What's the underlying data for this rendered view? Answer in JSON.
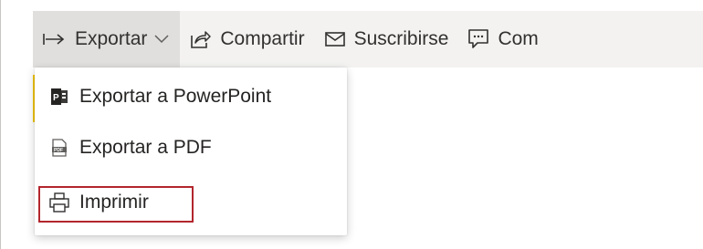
{
  "toolbar": {
    "items": [
      {
        "label": "Exportar",
        "icon": "arrow-right-icon"
      },
      {
        "label": "Compartir",
        "icon": "share-icon"
      },
      {
        "label": "Suscribirse",
        "icon": "mail-icon"
      },
      {
        "label": "Com",
        "icon": "comment-icon"
      }
    ]
  },
  "export_menu": {
    "items": [
      {
        "label": "Exportar a PowerPoint",
        "icon": "powerpoint-icon"
      },
      {
        "label": "Exportar a PDF",
        "icon": "pdf-icon"
      },
      {
        "label": "Imprimir",
        "icon": "printer-icon"
      }
    ]
  },
  "colors": {
    "accent": "#f2c811",
    "highlight_border": "#b3262d",
    "toolbar_bg": "#f3f2f1"
  }
}
